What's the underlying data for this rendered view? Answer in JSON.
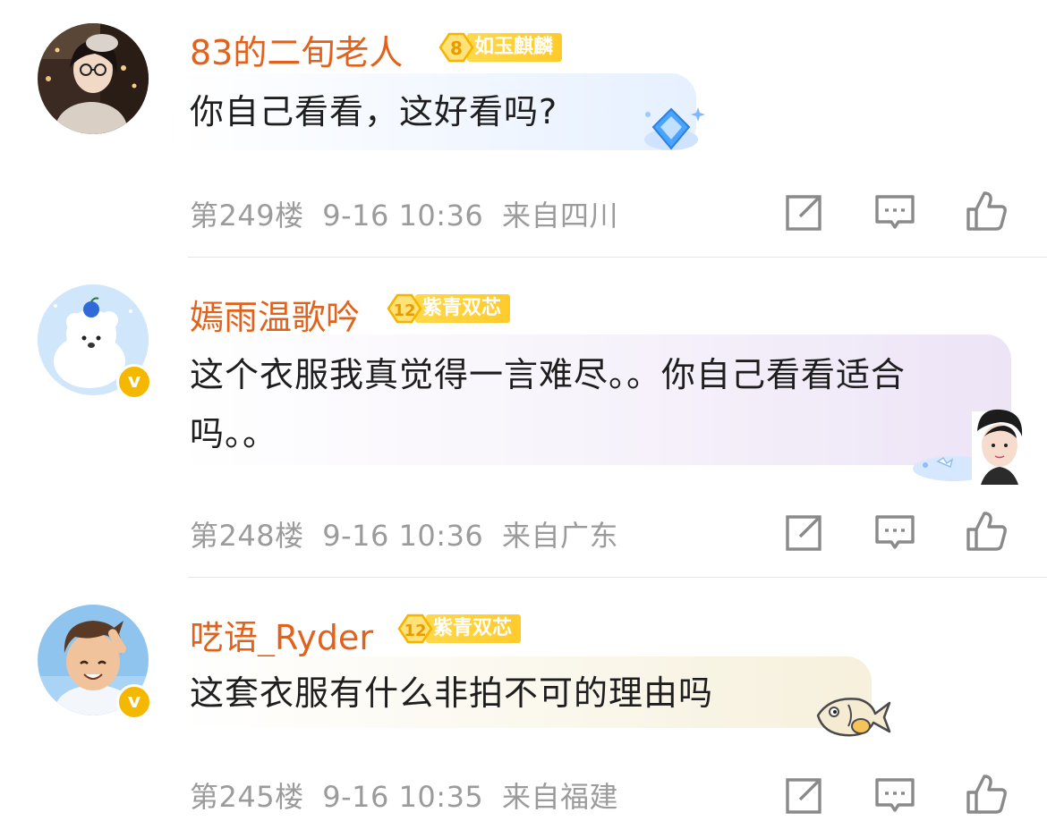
{
  "comments": [
    {
      "username": "83的二旬老人",
      "fan_level": "8",
      "fan_title": "如玉麒麟",
      "verified": false,
      "content": "你自己看看，这好看吗?",
      "floor": "第249楼",
      "time": "9-16 10:36",
      "location": "来自四川"
    },
    {
      "username": "嫣雨温歌吟",
      "fan_level": "12",
      "fan_title": "紫青双芯",
      "verified": true,
      "verified_mark": "v",
      "content": "这个衣服我真觉得一言难尽。。你自己看看适合吗。。",
      "floor": "第248楼",
      "time": "9-16 10:36",
      "location": "来自广东"
    },
    {
      "username": "呓语_Ryder",
      "fan_level": "12",
      "fan_title": "紫青双芯",
      "verified": true,
      "verified_mark": "v",
      "content": "这套衣服有什么非拍不可的理由吗",
      "floor": "第245楼",
      "time": "9-16 10:35",
      "location": "来自福建"
    }
  ],
  "icons": {
    "share": "share-icon",
    "reply": "comment-icon",
    "like": "thumbs-up-icon"
  },
  "colors": {
    "username": "#e2621b",
    "meta": "#9b9b9b",
    "badge": "#ffcb2b",
    "verified": "#f5b800"
  }
}
